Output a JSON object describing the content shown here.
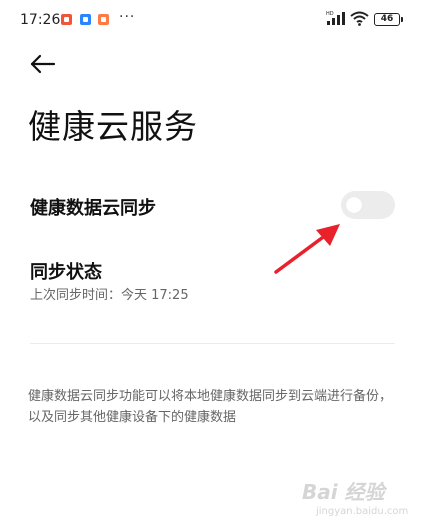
{
  "status_bar": {
    "time": "17:26",
    "notifications": [
      "app-notification-icon",
      "app-notification-icon",
      "app-notification-icon"
    ],
    "more": "···",
    "battery": "46"
  },
  "header": {
    "back_icon": "back-arrow-icon",
    "title": "健康云服务"
  },
  "settings": {
    "sync_label": "健康数据云同步",
    "sync_enabled": false,
    "status_label": "同步状态",
    "status_detail": "上次同步时间：今天 17:25"
  },
  "description": "健康数据云同步功能可以将本地健康数据同步到云端进行备份，以及同步其他健康设备下的健康数据",
  "watermark": {
    "text": "Bai 经验",
    "sub": "jingyan.baidu.com"
  },
  "colors": {
    "annotation": "#e8212b",
    "toggle_off": "#ececec"
  }
}
